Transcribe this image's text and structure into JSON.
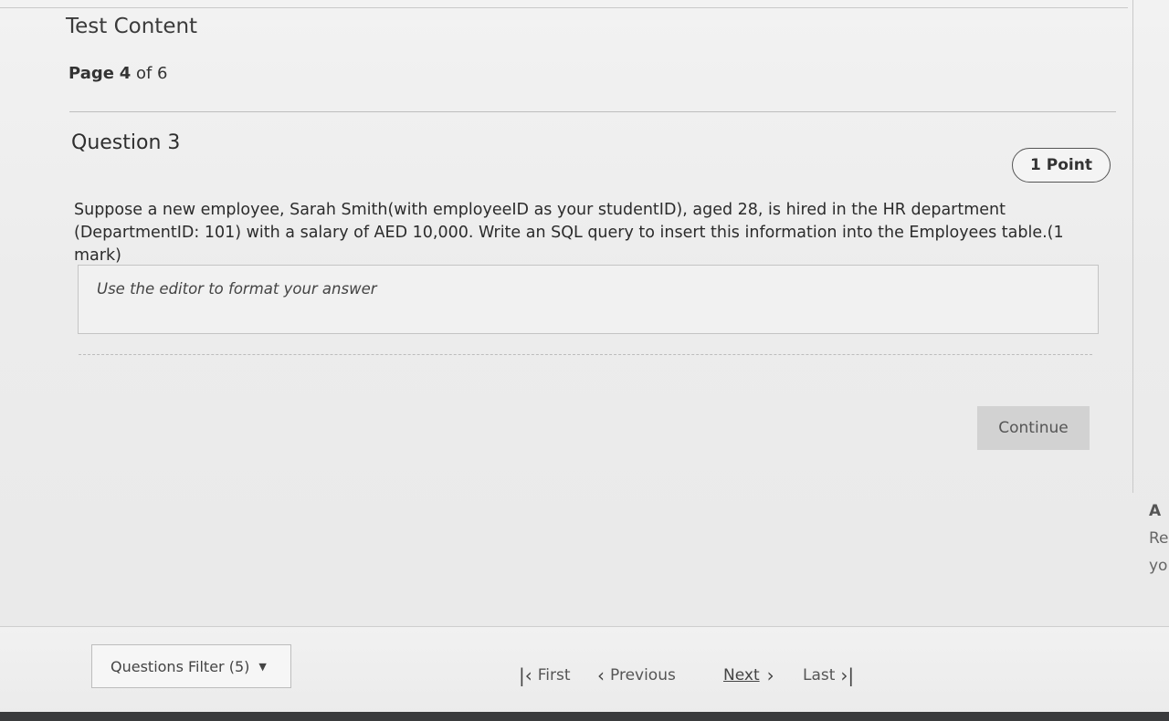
{
  "header": {
    "title": "Test Content",
    "page_prefix": "Page",
    "page_current": "4",
    "page_suffix": "of 6"
  },
  "question": {
    "title": "Question 3",
    "points": "1 Point",
    "text": "Suppose a new employee, Sarah Smith(with employeeID as your studentID), aged 28, is hired in the HR department (DepartmentID: 101) with a salary of AED 10,000. Write an SQL query to insert this information into the Employees table.(1 mark)",
    "answer_placeholder": "Use the editor to format your answer"
  },
  "actions": {
    "continue_label": "Continue"
  },
  "side_panel": {
    "line1": "A",
    "line2": "Re",
    "line3": "yo"
  },
  "footer": {
    "filter_label": "Questions Filter (5)",
    "first_label": "First",
    "previous_label": "Previous",
    "next_label": "Next",
    "last_label": "Last"
  },
  "icons": {
    "first": "skip-to-first-icon",
    "previous": "chevron-left-icon",
    "next": "chevron-right-icon",
    "last": "skip-to-last-icon",
    "filter": "caret-down-icon"
  }
}
